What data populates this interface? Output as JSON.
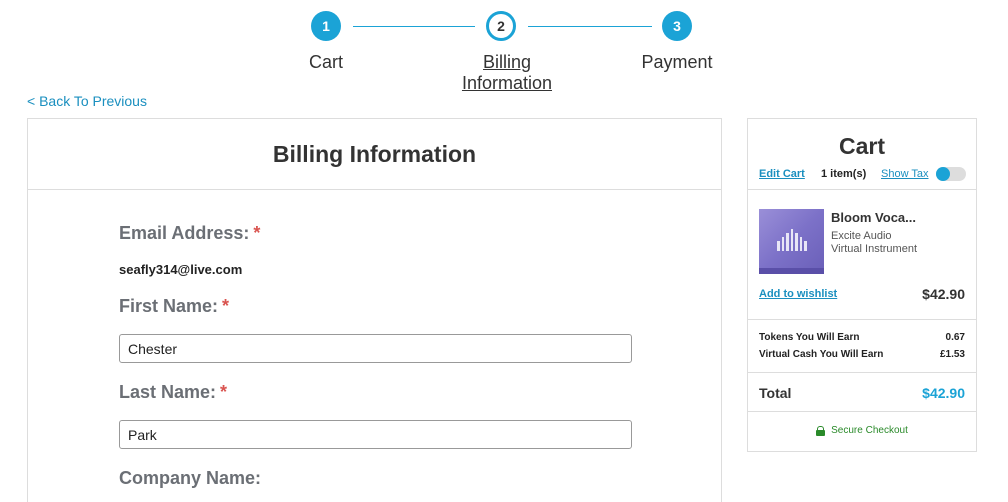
{
  "stepper": {
    "steps": [
      {
        "number": "1",
        "label": "Cart",
        "active": false
      },
      {
        "number": "2",
        "label_line1": "Billing",
        "label_line2": "Information",
        "active": true
      },
      {
        "number": "3",
        "label": "Payment",
        "active": false
      }
    ],
    "accent_color": "#1ba3d6"
  },
  "back_link": "< Back To Previous",
  "billing": {
    "title": "Billing Information",
    "email_label": "Email Address:",
    "email_value": "seafly314@live.com",
    "first_name_label": "First Name:",
    "first_name_value": "Chester",
    "last_name_label": "Last Name:",
    "last_name_value": "Park",
    "company_label": "Company Name:",
    "required_marker": "*"
  },
  "cart": {
    "title": "Cart",
    "edit_cart": "Edit Cart",
    "item_count": "1 item(s)",
    "show_tax": "Show Tax",
    "show_tax_on": true,
    "product": {
      "name": "Bloom Voca...",
      "brand": "Excite Audio",
      "type": "Virtual Instrument",
      "price": "$42.90"
    },
    "add_to_wishlist": "Add to wishlist",
    "tokens_label": "Tokens You Will Earn",
    "tokens_value": "0.67",
    "virtual_cash_label": "Virtual Cash You Will Earn",
    "virtual_cash_value": "£1.53",
    "total_label": "Total",
    "total_value": "$42.90",
    "secure_checkout": "Secure Checkout"
  }
}
